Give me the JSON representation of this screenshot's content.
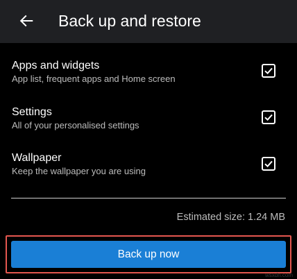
{
  "app_bar": {
    "title": "Back up and restore",
    "back_icon": "arrow-left-icon",
    "background": "#1f2023"
  },
  "options": [
    {
      "title": "Apps and widgets",
      "subtitle": "App list, frequent apps and Home screen",
      "checked": true
    },
    {
      "title": "Settings",
      "subtitle": "All of your personalised settings",
      "checked": true
    },
    {
      "title": "Wallpaper",
      "subtitle": "Keep the wallpaper you are using",
      "checked": true
    }
  ],
  "estimate": {
    "text": "Estimated size: 1.24 MB"
  },
  "backup_button": {
    "label": "Back up now",
    "color": "#1a7fd6",
    "highlight_color": "#e5574f"
  },
  "watermark": "wsxdn.com",
  "icons": {
    "checkbox": "checkbox-checked-icon"
  }
}
